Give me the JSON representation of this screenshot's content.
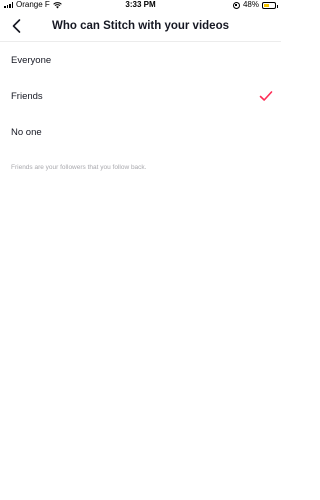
{
  "status_bar": {
    "carrier": "Orange F",
    "time": "3:33 PM",
    "battery": "48%",
    "battery_level": 0.48
  },
  "header": {
    "title": "Who can Stitch with your videos",
    "back_icon": "chevron-left-icon"
  },
  "options": [
    {
      "label": "Everyone",
      "selected": false
    },
    {
      "label": "Friends",
      "selected": true
    },
    {
      "label": "No one",
      "selected": false
    }
  ],
  "hint": "Friends are your followers that you follow back.",
  "colors": {
    "accent": "#fe2c55",
    "hint_text": "#a8a8ad",
    "battery_fill": "#f5c400"
  }
}
